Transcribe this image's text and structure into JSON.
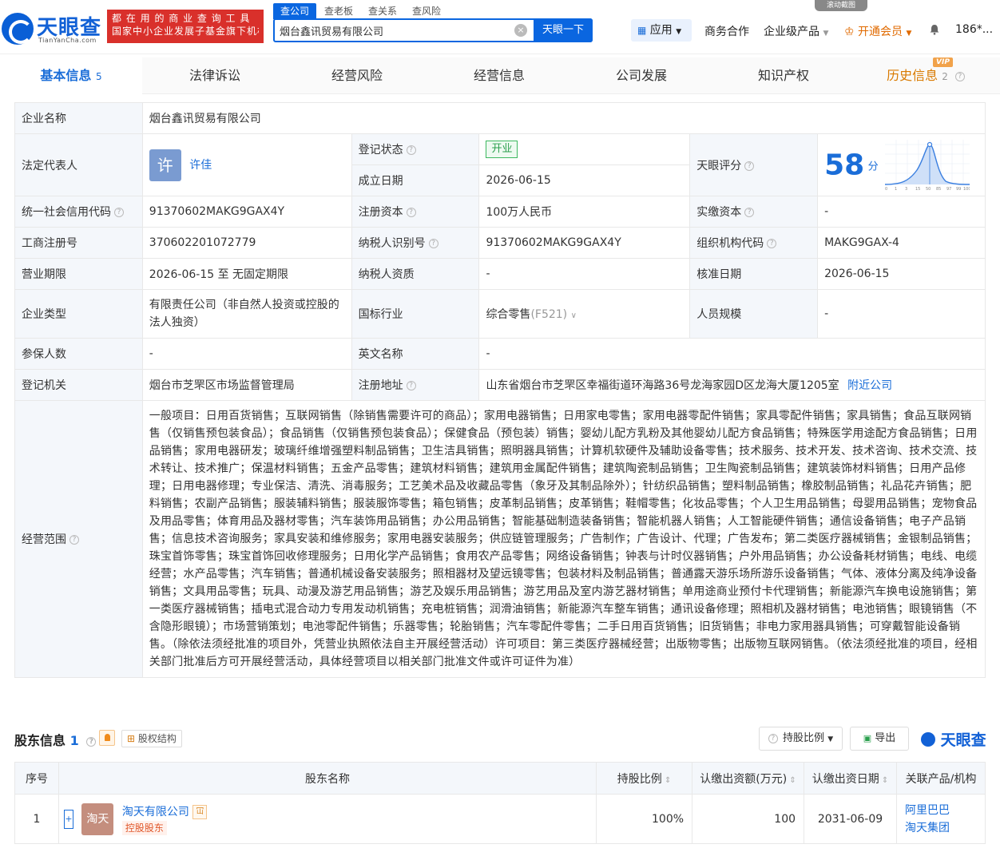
{
  "header": {
    "logo_text": "天眼查",
    "logo_sub": "TianYanCha.com",
    "slogan_line1": "都 在 用 的 商 业 查 询 工 具",
    "slogan_line2": "国家中小企业发展子基金旗下机构",
    "search_tabs": [
      "查公司",
      "查老板",
      "查关系",
      "查风险"
    ],
    "search_value": "烟台鑫讯贸易有限公司",
    "clear_symbol": "×",
    "search_button": "天眼一下",
    "nav": {
      "apps": "应用",
      "business": "商务合作",
      "enterprise": "企业级产品",
      "vip": "开通会员",
      "user": "186*..."
    },
    "scroll_screenshot": "滚动截图"
  },
  "tabs": [
    {
      "label": "基本信息",
      "count": "5"
    },
    {
      "label": "法律诉讼",
      "count": ""
    },
    {
      "label": "经营风险",
      "count": ""
    },
    {
      "label": "经营信息",
      "count": ""
    },
    {
      "label": "公司发展",
      "count": ""
    },
    {
      "label": "知识产权",
      "count": ""
    },
    {
      "label": "历史信息",
      "count": "2"
    }
  ],
  "vip_badge": "VIP",
  "info": {
    "company_name_label": "企业名称",
    "company_name": "烟台鑫讯贸易有限公司",
    "legal_rep_label": "法定代表人",
    "legal_rep_avatar": "许",
    "legal_rep": "许佳",
    "reg_status_label": "登记状态",
    "reg_status": "开业",
    "est_date_label": "成立日期",
    "est_date": "2026-06-15",
    "score_label": "天眼评分",
    "score": "58",
    "score_unit": "分",
    "score_ticks": [
      "0",
      "1",
      "3",
      "15",
      "50",
      "85",
      "97",
      "99",
      "100"
    ],
    "credit_code_label": "统一社会信用代码",
    "credit_code": "91370602MAKG9GAX4Y",
    "reg_capital_label": "注册资本",
    "reg_capital": "100万人民币",
    "paid_capital_label": "实缴资本",
    "paid_capital": "-",
    "biz_reg_no_label": "工商注册号",
    "biz_reg_no": "370602201072779",
    "taxpayer_id_label": "纳税人识别号",
    "taxpayer_id": "91370602MAKG9GAX4Y",
    "org_code_label": "组织机构代码",
    "org_code": "MAKG9GAX-4",
    "biz_term_label": "营业期限",
    "biz_term": "2026-06-15 至 无固定期限",
    "taxpayer_qual_label": "纳税人资质",
    "taxpayer_qual": "-",
    "approval_date_label": "核准日期",
    "approval_date": "2026-06-15",
    "company_type_label": "企业类型",
    "company_type": "有限责任公司（非自然人投资或控股的法人独资）",
    "industry_label": "国标行业",
    "industry": "综合零售",
    "industry_code": "(F521)",
    "staff_size_label": "人员规模",
    "staff_size": "-",
    "insured_label": "参保人数",
    "insured": "-",
    "english_name_label": "英文名称",
    "english_name": "-",
    "reg_authority_label": "登记机关",
    "reg_authority": "烟台市芝罘区市场监督管理局",
    "reg_address_label": "注册地址",
    "reg_address": "山东省烟台市芝罘区幸福街道环海路36号龙海家园D区龙海大厦1205室",
    "nearby_link": "附近公司",
    "scope_label": "经营范围",
    "scope": "一般项目：日用百货销售；互联网销售（除销售需要许可的商品）；家用电器销售；日用家电零售；家用电器零配件销售；家具零配件销售；家具销售；食品互联网销售（仅销售预包装食品）；食品销售（仅销售预包装食品）；保健食品（预包装）销售；婴幼儿配方乳粉及其他婴幼儿配方食品销售；特殊医学用途配方食品销售；日用品销售；家用电器研发；玻璃纤维增强塑料制品销售；卫生洁具销售；照明器具销售；计算机软硬件及辅助设备零售；技术服务、技术开发、技术咨询、技术交流、技术转让、技术推广；保温材料销售；五金产品零售；建筑材料销售；建筑用金属配件销售；建筑陶瓷制品销售；卫生陶瓷制品销售；建筑装饰材料销售；日用产品修理；日用电器修理；专业保洁、清洗、消毒服务；工艺美术品及收藏品零售（象牙及其制品除外）；针纺织品销售；塑料制品销售；橡胶制品销售；礼品花卉销售；肥料销售；农副产品销售；服装辅料销售；服装服饰零售；箱包销售；皮革制品销售；皮革销售；鞋帽零售；化妆品零售；个人卫生用品销售；母婴用品销售；宠物食品及用品零售；体育用品及器材零售；汽车装饰用品销售；办公用品销售；智能基础制造装备销售；智能机器人销售；人工智能硬件销售；通信设备销售；电子产品销售；信息技术咨询服务；家具安装和维修服务；家用电器安装服务；供应链管理服务；广告制作；广告设计、代理；广告发布；第二类医疗器械销售；金银制品销售；珠宝首饰零售；珠宝首饰回收修理服务；日用化学产品销售；食用农产品零售；网络设备销售；钟表与计时仪器销售；户外用品销售；办公设备耗材销售；电线、电缆经营；水产品零售；汽车销售；普通机械设备安装服务；照相器材及望远镜零售；包装材料及制品销售；普通露天游乐场所游乐设备销售；气体、液体分离及纯净设备销售；文具用品零售；玩具、动漫及游艺用品销售；游艺及娱乐用品销售；游艺用品及室内游艺器材销售；单用途商业预付卡代理销售；新能源汽车换电设施销售；第一类医疗器械销售；插电式混合动力专用发动机销售；充电桩销售；润滑油销售；新能源汽车整车销售；通讯设备修理；照相机及器材销售；电池销售；眼镜销售（不含隐形眼镜）；市场营销策划；电池零配件销售；乐器零售；轮胎销售；汽车零配件零售；二手日用百货销售；旧货销售；非电力家用器具销售；可穿戴智能设备销售。（除依法须经批准的项目外，凭营业执照依法自主开展经营活动）许可项目：第三类医疗器械经营；出版物零售；出版物互联网销售。（依法须经批准的项目，经相关部门批准后方可开展经营活动，具体经营项目以相关部门批准文件或许可证件为准）"
  },
  "shareholders": {
    "title": "股东信息",
    "count": "1",
    "equity_button": "股权结构",
    "ratio_button": "持股比例",
    "export_button": "导出",
    "brand": "天眼查",
    "columns": [
      "序号",
      "股东名称",
      "持股比例",
      "认缴出资额(万元)",
      "认缴出资日期",
      "关联产品/机构"
    ],
    "rows": [
      {
        "index": "1",
        "logo": "淘天",
        "name": "淘天有限公司",
        "tag": "控股股东",
        "name_badge": "冚",
        "ratio": "100%",
        "amount": "100",
        "date": "2031-06-09",
        "related": [
          "阿里巴巴",
          "淘天集团"
        ]
      }
    ]
  },
  "colors": {
    "primary": "#1a6dd8",
    "brand_red": "#d9302b",
    "status_green": "#2a9f4d",
    "vip_orange": "#e06a00"
  }
}
